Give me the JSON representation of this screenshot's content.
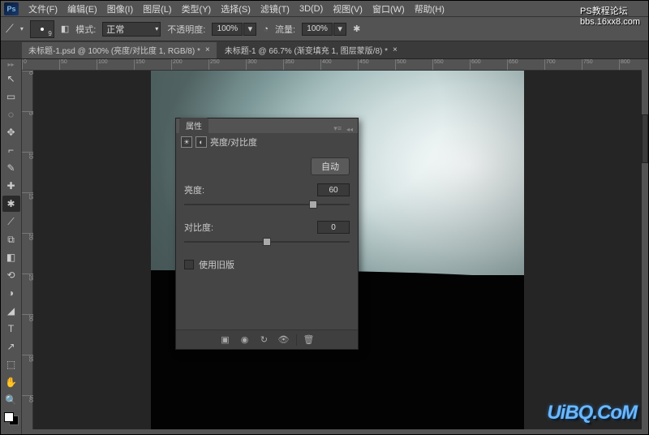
{
  "watermark": {
    "line1": "PS教程论坛",
    "line2": "bbs.16xx8.com",
    "logo": "UiBQ.CoM"
  },
  "menu": {
    "file": "文件(F)",
    "edit": "编辑(E)",
    "image": "图像(I)",
    "layer": "图层(L)",
    "type": "类型(Y)",
    "select": "选择(S)",
    "filter": "滤镜(T)",
    "threeD": "3D(D)",
    "view": "视图(V)",
    "window": "窗口(W)",
    "help": "帮助(H)"
  },
  "options": {
    "mode_label": "模式:",
    "mode_value": "正常",
    "opacity_label": "不透明度:",
    "opacity_value": "100%",
    "flow_label": "流量:",
    "flow_value": "100%",
    "brush_size": "9"
  },
  "tabs": [
    {
      "label": "未标题-1.psd @ 100% (亮度/对比度 1, RGB/8) *"
    },
    {
      "label": "未标题-1 @ 66.7% (渐变填充 1, 图层蒙版/8) *"
    }
  ],
  "ruler_h": [
    "0",
    "50",
    "100",
    "150",
    "200",
    "250",
    "300",
    "350",
    "400",
    "450",
    "500",
    "550",
    "600",
    "650",
    "700",
    "750",
    "800"
  ],
  "ruler_v": [
    "0",
    "5",
    "10",
    "15",
    "20",
    "25",
    "30",
    "35",
    "40"
  ],
  "tools": [
    "↖",
    "▭",
    "◌",
    "✥",
    "⌐",
    "✎",
    "✚",
    "✱",
    "⟋",
    "⧉",
    "◧",
    "⟲",
    "◑",
    "◢",
    "✒",
    "T",
    "↗",
    "⬚",
    "✋",
    "🔍"
  ],
  "panel": {
    "tab": "属性",
    "title": "亮度/对比度",
    "auto": "自动",
    "brightness": {
      "label": "亮度:",
      "value": "60",
      "pct": 78
    },
    "contrast": {
      "label": "对比度:",
      "value": "0",
      "pct": 50
    },
    "legacy": "使用旧版"
  }
}
